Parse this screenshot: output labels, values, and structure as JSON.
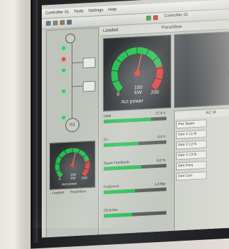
{
  "menu": {
    "items": [
      "Controller 01",
      "Tools",
      "Settings",
      "Help"
    ]
  },
  "toolbar": {
    "status_label": "Controller 01"
  },
  "left_panel": {
    "breaker_labels": [
      "Loaded",
      "ParaAllow"
    ],
    "gen_label": "G1",
    "gauge": {
      "min": "0",
      "mid": "100",
      "max": "200",
      "unit": "kW",
      "caption": "Act power",
      "needle_fraction": 0.55
    }
  },
  "main_panel": {
    "header_left": "Loaded",
    "header_right": "ParaAllow",
    "gauge": {
      "min": "0",
      "mid": "100",
      "max": "200",
      "unit": "kW",
      "caption": "Act power",
      "needle_fraction": 0.55
    },
    "rows": [
      {
        "label": "Ubat",
        "value": "27,8 V",
        "fill": 0.75
      },
      {
        "label": "D+",
        "value": "0,0 V",
        "fill": 0.55
      },
      {
        "label": "Spare Feedback",
        "value": "0,0 %",
        "fill": 0.6
      },
      {
        "label": "FuelLevel",
        "value": "1,3 Bar",
        "fill": 0.5
      },
      {
        "label": "Oil press",
        "value": "",
        "fill": 0.45
      }
    ],
    "ac_panel": {
      "title": "AC M",
      "rows": [
        "Pwr Spare",
        "Gen V L1-N",
        "Gen V L2-N",
        "Gen V L3-N",
        "Gen Freq",
        "Gen Curr"
      ]
    }
  },
  "colors": {
    "led_green": "#29d15a",
    "led_red": "#e8403a",
    "bar_green": "#22c04d",
    "gauge_red": "#e03b36"
  }
}
